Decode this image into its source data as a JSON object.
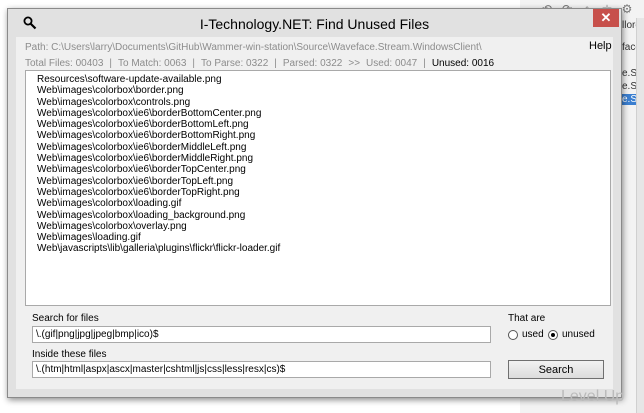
{
  "window": {
    "title": "I-Technology.NET: Find Unused Files",
    "close_label": "✕",
    "help_label": "Help"
  },
  "path_text": "Path: C:\\Users\\larry\\Documents\\GitHub\\Wammer-win-station\\Source\\Waveface.Stream.WindowsClient\\",
  "stats": {
    "total": "Total Files: 00403",
    "to_match": "To Match: 0063",
    "to_parse": "To Parse: 0322",
    "parsed": "Parsed: 0322",
    "arrow": ">>",
    "used": "Used: 0047",
    "unused": "Unused: 0016"
  },
  "results": [
    "Resources\\software-update-available.png",
    "Web\\images\\colorbox\\border.png",
    "Web\\images\\colorbox\\controls.png",
    "Web\\images\\colorbox\\ie6\\borderBottomCenter.png",
    "Web\\images\\colorbox\\ie6\\borderBottomLeft.png",
    "Web\\images\\colorbox\\ie6\\borderBottomRight.png",
    "Web\\images\\colorbox\\ie6\\borderMiddleLeft.png",
    "Web\\images\\colorbox\\ie6\\borderMiddleRight.png",
    "Web\\images\\colorbox\\ie6\\borderTopCenter.png",
    "Web\\images\\colorbox\\ie6\\borderTopLeft.png",
    "Web\\images\\colorbox\\ie6\\borderTopRight.png",
    "Web\\images\\colorbox\\loading.gif",
    "Web\\images\\colorbox\\loading_background.png",
    "Web\\images\\colorbox\\overlay.png",
    "Web\\images\\loading.gif",
    "Web\\javascripts\\lib\\galleria\\plugins\\flickr\\flickr-loader.gif"
  ],
  "search_for": {
    "label": "Search for files",
    "value": "\\.(gif|png|jpg|jpeg|bmp|ico)$"
  },
  "inside": {
    "label": "Inside these files",
    "value": "\\.(htm|html|aspx|ascx|master|cshtml|js|css|less|resx|cs)$"
  },
  "that_are": {
    "label": "That are",
    "used_label": "used",
    "unused_label": "unused",
    "selected": "unused"
  },
  "search_button": "Search",
  "background_app": {
    "text_1": "llore",
    "text_2": "face",
    "text_3": "e.S",
    "text_4": "e.S",
    "text_5": "e.S"
  },
  "watermark": "Level Up",
  "colors": {
    "close_button": "#c7504b",
    "window_frame": "#e1e1e1",
    "client_bg": "#f0f0f0"
  }
}
